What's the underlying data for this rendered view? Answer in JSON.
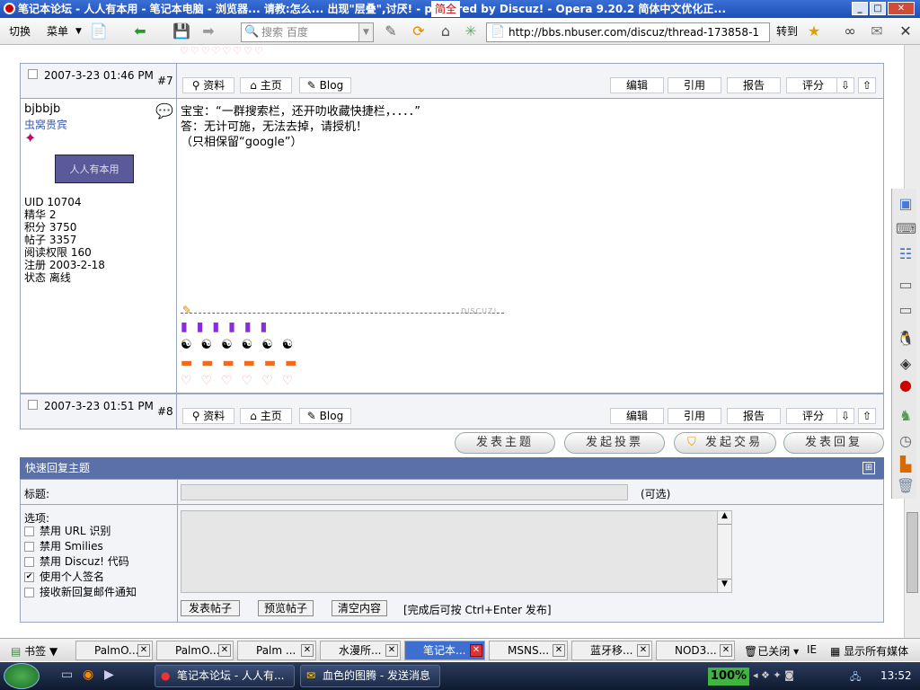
{
  "window": {
    "title": "笔记本论坛 - 人人有本用 - 笔记本电脑 - 浏览器... 请教:怎么... 出现\"层叠\",讨厌! - powered by Discuz! - Opera 9.20.2 简体中文优化正...",
    "ime": "简全"
  },
  "toolbar": {
    "switch_label": "切换",
    "menu_label": "菜单",
    "search_placeholder": "搜索 百度",
    "url": "http://bbs.nbuser.com/discuz/thread-173858-1",
    "goto_label": "转到"
  },
  "post7": {
    "date": "2007-3-23 01:46 PM",
    "number": "#7",
    "btn_profile": "资料",
    "btn_home": "主页",
    "btn_blog": "Blog",
    "btn_edit": "编辑",
    "btn_quote": "引用",
    "btn_report": "报告",
    "btn_rate": "评分"
  },
  "post8": {
    "author": "bjbbjb",
    "group": "虫窝贵宾",
    "title_bar": "人人有本用",
    "stats": [
      "UID 10704",
      "精华 2",
      "积分 3750",
      "帖子 3357",
      "阅读权限 160",
      "注册 2003-2-18",
      "状态 离线"
    ],
    "body_lines": [
      "宝宝：“一群搜索栏，还开叻收藏快捷栏，．．．．”",
      "答：无计可施，无法去掉，请授机！",
      "（只相保留“google”）"
    ],
    "sig_watermark": "DISCUZ!",
    "date": "2007-3-23 01:51 PM",
    "number": "#8",
    "btn_profile": "资料",
    "btn_home": "主页",
    "btn_blog": "Blog",
    "btn_edit": "编辑",
    "btn_quote": "引用",
    "btn_report": "报告",
    "btn_rate": "评分"
  },
  "actions": {
    "new_topic": "发表主题",
    "new_poll": "发起投票",
    "new_trade": "发起交易",
    "reply": "发表回复"
  },
  "quickreply": {
    "header": "快速回复主题",
    "subject_label": "标题:",
    "optional": "(可选)",
    "options_label": "选项:",
    "opt1": "禁用 URL 识别",
    "opt2": "禁用 Smilies",
    "opt3": "禁用 Discuz! 代码",
    "opt4": "使用个人签名",
    "opt5": "接收新回复邮件通知",
    "submit": "发表帖子",
    "preview": "预览帖子",
    "clear": "清空内容",
    "hint": "[完成后可按 Ctrl+Enter 发布]"
  },
  "tabs": {
    "bookmarks": "书签",
    "t1": "PalmO...",
    "t2": "PalmO...",
    "t3": "Palm ...",
    "t4": "水漫所...",
    "t5": "笔记本...",
    "t6": "MSNS...",
    "t7": "蓝牙移...",
    "t8": "NOD3...",
    "closed": "已关闭",
    "ie": "IE",
    "media": "显示所有媒体"
  },
  "taskbar": {
    "task1": "笔记本论坛 - 人人有...",
    "task2": "血色的图腾 - 发送消息",
    "zoom": "100%",
    "clock": "13:52"
  }
}
